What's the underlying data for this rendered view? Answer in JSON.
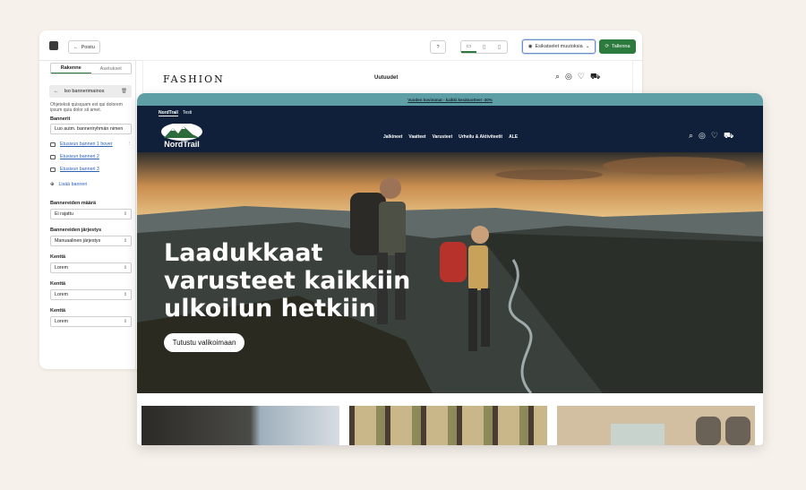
{
  "editor": {
    "back_label": "Poistu",
    "help_icon": "help-icon",
    "devices": [
      "desktop-icon",
      "tablet-icon",
      "mobile-icon"
    ],
    "preview_label": "Esikatselet muutoksia",
    "save_label": "Tallenna",
    "accent": "#2d7a3e"
  },
  "sidebar": {
    "tabs": [
      "Rakenne",
      "Asetukset"
    ],
    "section_title": "Iso bannerimainos",
    "description": "Ohjeteksti quisquam est qui dolorem ipsum quia dolor sit amet.",
    "banners_label": "Bannerit",
    "banner_group_value": "Luo autm. banneriryhmän nimen",
    "banners": [
      "Etusivun banneri 1 hover",
      "Etusivun banneri 2",
      "Etusivun banneri 3"
    ],
    "add_banner": "Lisää banneri",
    "fields": [
      {
        "label": "Bannereiden määrä",
        "value": "Ei rajattu"
      },
      {
        "label": "Bannereiden järjestys",
        "value": "Manuaalinen järjestys"
      },
      {
        "label": "Kenttä",
        "value": "Lorem"
      },
      {
        "label": "Kenttä",
        "value": "Lorem"
      },
      {
        "label": "Kenttä",
        "value": "Lorem"
      }
    ]
  },
  "fashion": {
    "logo": "FASHION",
    "nav": "Uutuudet"
  },
  "store": {
    "announcement": "Vuoden kovimmat - kaikki kesätuotteet -30%",
    "langs": [
      "NordTrail",
      "Testi"
    ],
    "logo": "NordTrail",
    "nav": [
      "Jalkineet",
      "Vaatteet",
      "Varusteet",
      "Urheilu & Aktiviteetit",
      "ALE"
    ],
    "hero_lines": [
      "Laadukkaat",
      "varusteet kaikkiin",
      "ulkoilun hetkiin"
    ],
    "hero_button": "Tutustu valikoimaan",
    "announce_color": "#5e9ea5",
    "header_color": "#10203a"
  }
}
